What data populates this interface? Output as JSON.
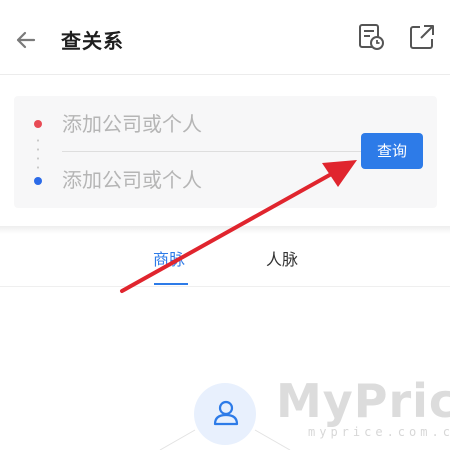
{
  "header": {
    "title": "查关系",
    "back_icon": "arrow-left-icon",
    "history_icon": "history-icon",
    "share_icon": "share-icon"
  },
  "query": {
    "from_placeholder": "添加公司或个人",
    "to_placeholder": "添加公司或个人",
    "submit_label": "查询"
  },
  "tabs": [
    {
      "label": "商脉",
      "active": true
    },
    {
      "label": "人脉",
      "active": false
    }
  ],
  "empty_state": {
    "icon": "person-icon"
  },
  "watermark": {
    "main": "MyPrice",
    "sub": "myprice.com.cn"
  },
  "annotation": {
    "type": "red-arrow",
    "color": "#e0252e"
  },
  "colors": {
    "accent": "#2d7be8",
    "from_dot": "#e84b55",
    "to_dot": "#2c6be8"
  }
}
